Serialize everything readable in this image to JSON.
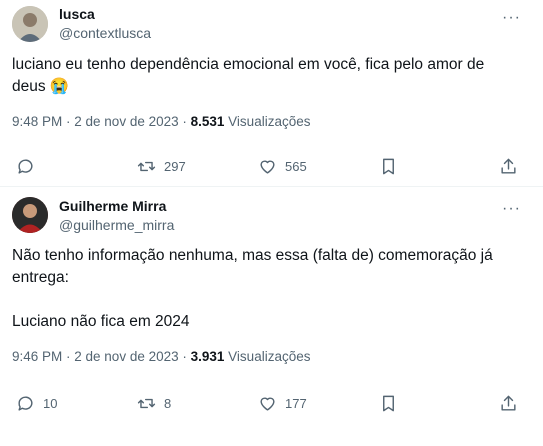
{
  "tweet1": {
    "name": "lusca",
    "handle": "@contextlusca",
    "text": "luciano eu tenho dependência emocional em você, fica pelo amor de\ndeus 😭",
    "time": "9:48 PM · 2 de nov de 2023 · ",
    "views_count": "8.531",
    "views_label": " Visualizações",
    "replies": "",
    "reposts": "297",
    "likes": "565"
  },
  "tweet2": {
    "name": "Guilherme Mirra",
    "handle": "@guilherme_mirra",
    "text": "Não tenho informação nenhuma, mas essa (falta de) comemoração já\nentrega:\n\nLuciano não fica em 2024",
    "time": "9:46 PM · 2 de nov de 2023 · ",
    "views_count": "3.931",
    "views_label": " Visualizações",
    "replies": "10",
    "reposts": "8",
    "likes": "177"
  },
  "icons": {
    "more": "more-dots-icon",
    "reply": "reply-bubble-icon",
    "repost": "repost-icon",
    "like": "heart-icon",
    "bookmark": "bookmark-icon",
    "share": "share-icon"
  },
  "more_glyph": "···"
}
